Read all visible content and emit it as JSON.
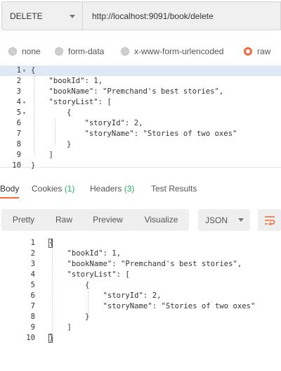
{
  "request": {
    "method": "DELETE",
    "url": "http://localhost:9091/book/delete"
  },
  "body_types": [
    {
      "label": "none",
      "selected": false
    },
    {
      "label": "form-data",
      "selected": false
    },
    {
      "label": "x-www-form-urlencoded",
      "selected": false
    },
    {
      "label": "raw",
      "selected": true
    }
  ],
  "request_body": [
    {
      "n": "1",
      "fold": "▾",
      "text": "{"
    },
    {
      "n": "2",
      "fold": "",
      "text": "    \"bookId\": 1,"
    },
    {
      "n": "3",
      "fold": "",
      "text": "    \"bookName\": \"Premchand's best stories\","
    },
    {
      "n": "4",
      "fold": "▾",
      "text": "    \"storyList\": ["
    },
    {
      "n": "5",
      "fold": "▾",
      "text": "        {"
    },
    {
      "n": "6",
      "fold": "",
      "text": "            \"storyId\": 2,"
    },
    {
      "n": "7",
      "fold": "",
      "text": "            \"storyName\": \"Stories of two oxes\""
    },
    {
      "n": "8",
      "fold": "",
      "text": "        }"
    },
    {
      "n": "9",
      "fold": "",
      "text": "    ]"
    },
    {
      "n": "10",
      "fold": "",
      "text": "}"
    }
  ],
  "response_tabs": {
    "body": "Body",
    "cookies": "Cookies",
    "cookies_count": "(1)",
    "headers": "Headers",
    "headers_count": "(3)",
    "tests": "Test Results"
  },
  "view_modes": [
    "Pretty",
    "Raw",
    "Preview",
    "Visualize"
  ],
  "format": "JSON",
  "response_body": [
    {
      "n": "1",
      "text": "{"
    },
    {
      "n": "2",
      "text": "    \"bookId\": 1,"
    },
    {
      "n": "3",
      "text": "    \"bookName\": \"Premchand's best stories\","
    },
    {
      "n": "4",
      "text": "    \"storyList\": ["
    },
    {
      "n": "5",
      "text": "        {"
    },
    {
      "n": "6",
      "text": "            \"storyId\": 2,"
    },
    {
      "n": "7",
      "text": "            \"storyName\": \"Stories of two oxes\""
    },
    {
      "n": "8",
      "text": "        }"
    },
    {
      "n": "9",
      "text": "    ]"
    },
    {
      "n": "10",
      "text": "}"
    }
  ],
  "colors": {
    "accent": "#f26b3a",
    "count": "#27ae60",
    "json_value": "#1a1aa6"
  },
  "icons": {
    "wrap": "wrap-lines-icon",
    "method_caret": "chevron-down-icon"
  }
}
